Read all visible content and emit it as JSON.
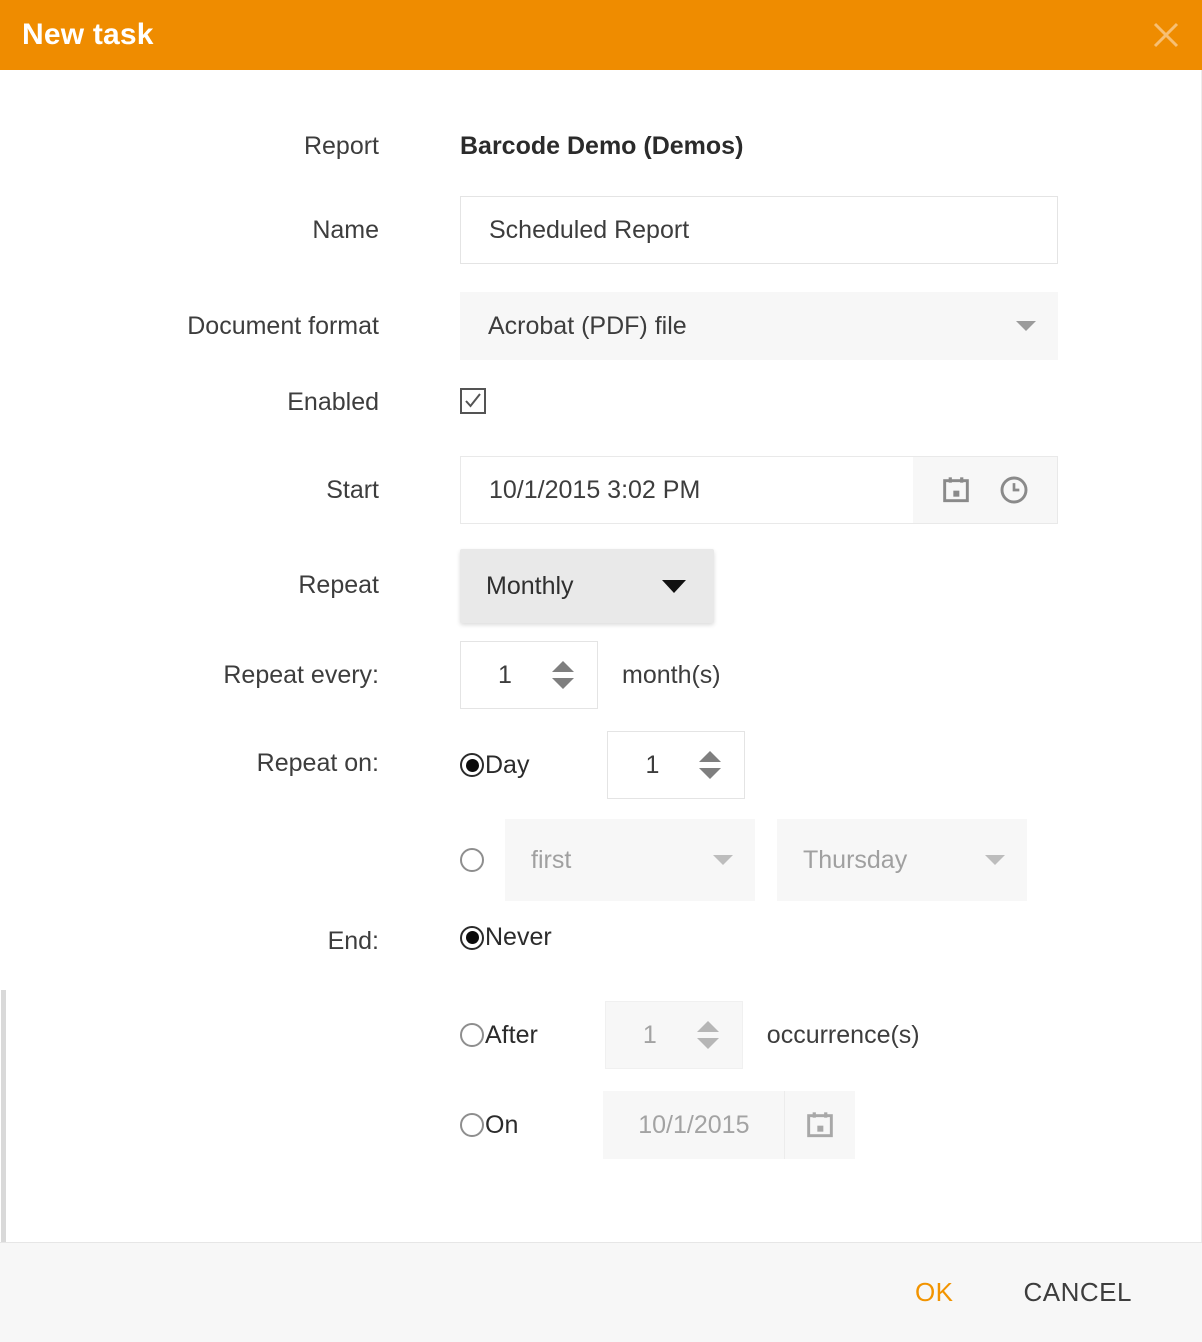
{
  "dialog": {
    "title": "New task",
    "close_icon": "close-icon"
  },
  "theme": {
    "header_bg": "#ef8c00",
    "accent": "#f29400",
    "body_bg": "#ffffff",
    "footer_bg": "#f7f7f7",
    "field_bg": "#f7f7f7",
    "text": "#3d3d3d",
    "disabled_text": "#a0a0a0"
  },
  "form": {
    "report": {
      "label": "Report",
      "value": "Barcode Demo (Demos)"
    },
    "name": {
      "label": "Name",
      "value": "Scheduled Report",
      "placeholder": "Scheduled Report"
    },
    "document_format": {
      "label": "Document format",
      "value": "Acrobat (PDF) file",
      "options": [
        "Acrobat (PDF) file"
      ]
    },
    "enabled": {
      "label": "Enabled",
      "checked": true
    },
    "start": {
      "label": "Start",
      "value": "10/1/2015 3:02 PM",
      "calendar_icon": "calendar-icon",
      "clock_icon": "clock-icon"
    },
    "repeat": {
      "label": "Repeat",
      "value": "Monthly",
      "options": [
        "Monthly"
      ]
    },
    "repeat_every": {
      "label": "Repeat every:",
      "value": "1",
      "unit": "month(s)"
    },
    "repeat_on": {
      "label": "Repeat on:",
      "day_option": {
        "label": "Day",
        "selected": true,
        "value": "1"
      },
      "ordinal_option": {
        "selected": false,
        "ordinal": "first",
        "ordinal_options": [
          "first"
        ],
        "weekday": "Thursday",
        "weekday_options": [
          "Thursday"
        ]
      }
    },
    "end": {
      "label": "End:",
      "never": {
        "label": "Never",
        "selected": true
      },
      "after": {
        "label": "After",
        "selected": false,
        "value": "1",
        "unit": "occurrence(s)"
      },
      "on": {
        "label": "On",
        "selected": false,
        "value": "10/1/2015",
        "calendar_icon": "calendar-icon"
      }
    }
  },
  "footer": {
    "ok_label": "OK",
    "cancel_label": "CANCEL"
  }
}
